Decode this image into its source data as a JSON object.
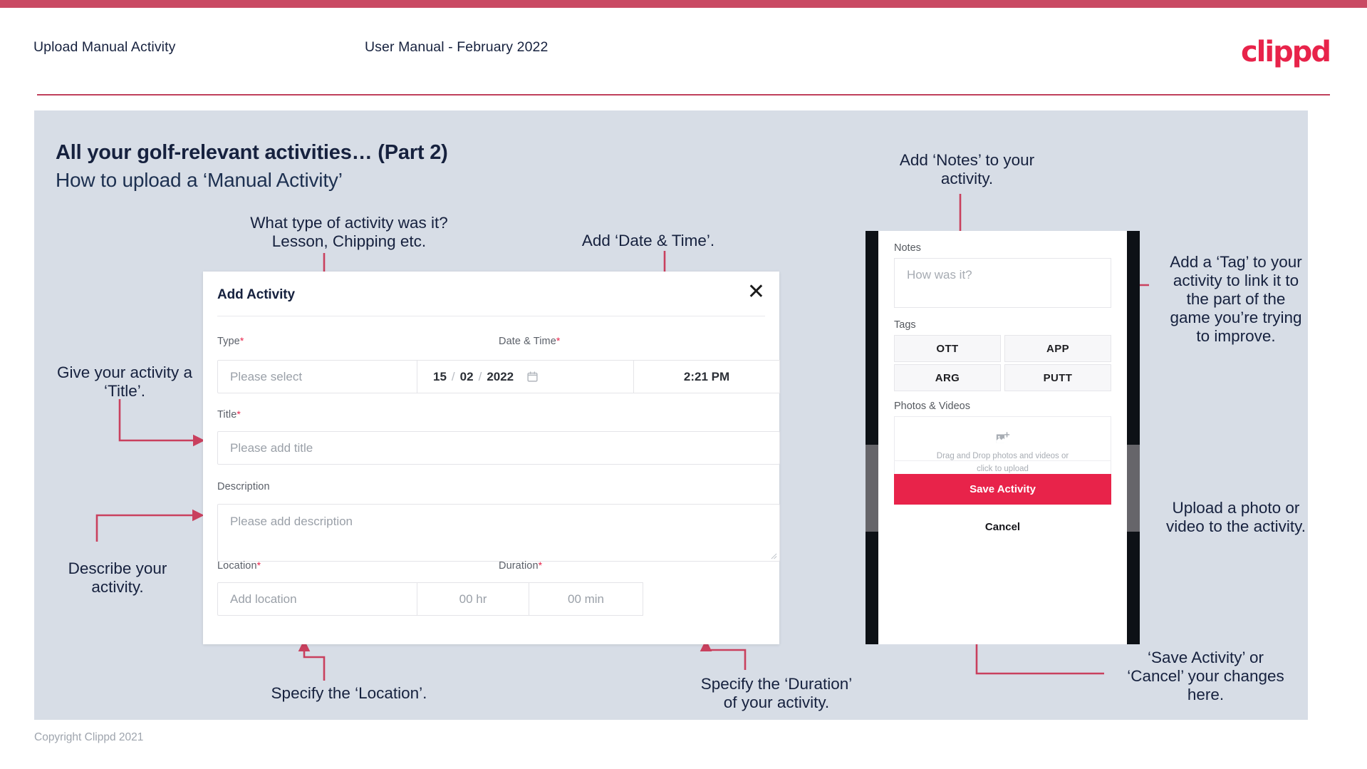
{
  "header": {
    "title": "Upload Manual Activity",
    "subtitle": "User Manual - February 2022",
    "logo": "clippd"
  },
  "slide": {
    "title": "All your golf-relevant activities… (Part 2)",
    "subtitle": "How to upload a ‘Manual Activity’",
    "footer": "Copyright Clippd 2021"
  },
  "dialog": {
    "title": "Add Activity",
    "close_icon": "close-icon",
    "fields": {
      "type": {
        "label": "Type",
        "required": "*",
        "placeholder": "Please select",
        "chevron_icon": "chevron-down-icon"
      },
      "datetime": {
        "label": "Date & Time",
        "required": "*",
        "day": "15",
        "month": "02",
        "year": "2022",
        "sep": "/",
        "calendar_icon": "calendar-icon",
        "time": "2:21 PM"
      },
      "title": {
        "label": "Title",
        "required": "*",
        "placeholder": "Please add title"
      },
      "description": {
        "label": "Description",
        "placeholder": "Please add description"
      },
      "location": {
        "label": "Location",
        "required": "*",
        "placeholder": "Add location"
      },
      "duration": {
        "label": "Duration",
        "required": "*",
        "hours": "00 hr",
        "minutes": "00 min"
      }
    }
  },
  "phone": {
    "notes": {
      "label": "Notes",
      "placeholder": "How was it?"
    },
    "tags": {
      "label": "Tags",
      "items": [
        "OTT",
        "APP",
        "ARG",
        "PUTT"
      ]
    },
    "photos": {
      "label": "Photos & Videos",
      "icon": "add-image-icon",
      "line1": "Drag and Drop photos and videos or",
      "line2": "click to upload"
    },
    "save_label": "Save Activity",
    "cancel_label": "Cancel"
  },
  "annotations": {
    "type": "What type of activity was it?\nLesson, Chipping etc.",
    "datetime": "Add ‘Date & Time’.",
    "title": "Give your activity a\n‘Title’.",
    "description": "Describe your\nactivity.",
    "location": "Specify the ‘Location’.",
    "duration": "Specify the ‘Duration’\nof your activity.",
    "notes": "Add ‘Notes’ to your\nactivity.",
    "tags": "Add a ‘Tag’ to your\nactivity to link it to\nthe part of the\ngame you’re trying\nto improve.",
    "photos": "Upload a photo or\nvideo to the activity.",
    "save": "‘Save Activity’ or\n‘Cancel’ your changes\nhere."
  },
  "colors": {
    "accent_bar": "#c94a63",
    "brand": "#e8234a",
    "panel_bg": "#d7dde6",
    "ink": "#16213e",
    "arrow": "#c9405e"
  }
}
